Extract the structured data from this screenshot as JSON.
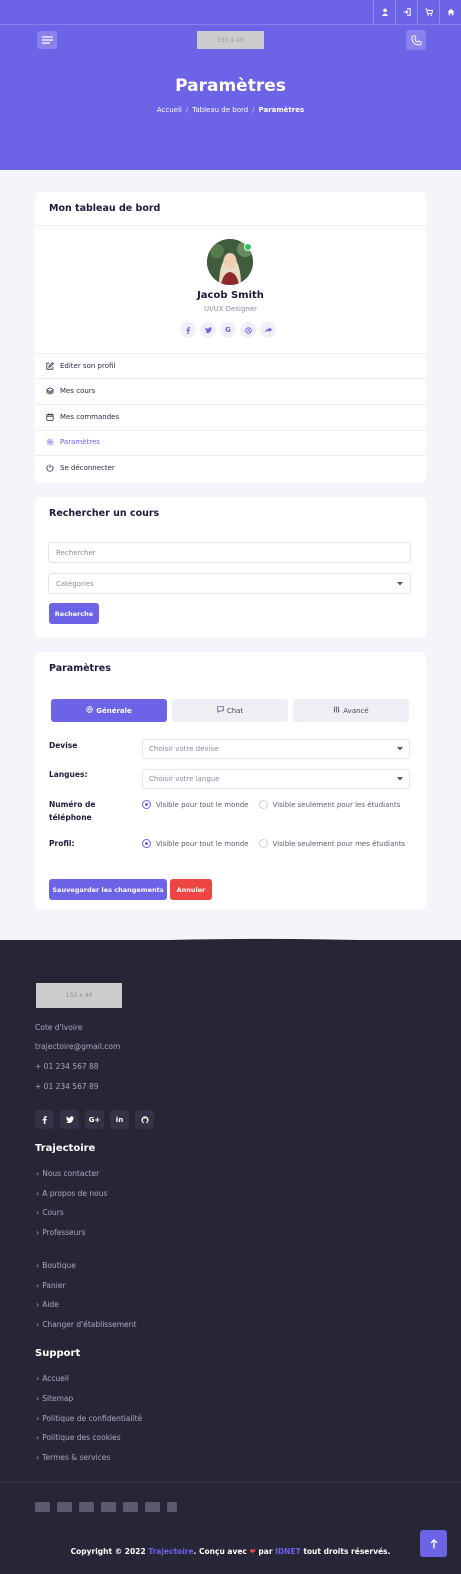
{
  "colors": {
    "primary": "#6c63e6",
    "danger": "#ef4444",
    "online": "#22c55e",
    "footer_bg": "#272637"
  },
  "topbar": {
    "icons": [
      "user-icon",
      "login-icon",
      "cart-icon",
      "home-icon"
    ]
  },
  "header": {
    "logo_placeholder": "150 x 40",
    "title": "Paramètres",
    "breadcrumb": {
      "home": "Accueil",
      "dashboard": "Tableau de bord",
      "current": "Paramètres"
    }
  },
  "dashboard": {
    "title": "Mon tableau de bord",
    "user": {
      "name": "Jacob Smith",
      "role": "UI/UX Designer"
    },
    "socials": [
      "facebook-icon",
      "twitter-icon",
      "google-icon",
      "dribbble-icon",
      "share-icon"
    ],
    "nav": [
      {
        "label": "Editer son profil",
        "icon": "edit-icon"
      },
      {
        "label": "Mes cours",
        "icon": "layers-icon"
      },
      {
        "label": "Mes commandes",
        "icon": "calendar-icon"
      },
      {
        "label": "Paramètres",
        "icon": "gear-icon"
      },
      {
        "label": "Se déconnecter",
        "icon": "power-icon"
      }
    ]
  },
  "search": {
    "title": "Rechercher un cours",
    "input_placeholder": "Rechercher",
    "category_placeholder": "Catégories",
    "button": "Recherche"
  },
  "settings": {
    "title": "Paramètres",
    "tabs": [
      {
        "label": "Générale",
        "icon": "globe-icon"
      },
      {
        "label": "Chat",
        "icon": "chat-icon"
      },
      {
        "label": "Avancé",
        "icon": "sliders-icon"
      }
    ],
    "currency": {
      "label": "Devise",
      "placeholder": "Choisir votre devise"
    },
    "languages": {
      "label": "Langues:",
      "placeholder": "Choisir votre langue"
    },
    "phone": {
      "label_line1": "Numéro de",
      "label_line2": "téléphone",
      "option1": "Visible pour tout le monde",
      "option2": "Visible seulement pour les étudiants"
    },
    "profile": {
      "label": "Profil:",
      "option1": "Visible pour tout le monde",
      "option2": "Visible seulement pour mes étudiants"
    },
    "save_button": "Sauvegarder les changements",
    "cancel_button": "Annuler"
  },
  "footer": {
    "logo_placeholder": "153 x 44",
    "contact": [
      "Cote d'Ivoire",
      "trajectoire@gmail.com",
      "+ 01 234 567 88",
      "+ 01 234 567 89"
    ],
    "socials": [
      "facebook-icon",
      "twitter-icon",
      "google-plus-icon",
      "linkedin-icon",
      "github-icon"
    ],
    "section1": {
      "title": "Trajectoire",
      "links": [
        "Nous contacter",
        "A propos de nous",
        "Cours",
        "Professeurs",
        "Boutique",
        "Panier",
        "Aide",
        "Changer d'établissement"
      ]
    },
    "section2": {
      "title": "Support",
      "links": [
        "Accueil",
        "Sitemap",
        "Politique de confidentialité",
        "Politique des cookies",
        "Termes & services"
      ]
    },
    "payments": [
      "amex-icon",
      "visa-icon",
      "card-icon",
      "mastercard-icon",
      "paypal-icon",
      "card2-icon",
      "stripe-icon"
    ],
    "copyright": {
      "prefix": "Copyright © 2022 ",
      "brand": "Trajectoire",
      "middle": ". Conçu avec ",
      "heart": "❤",
      "by": " par ",
      "company": "IDNET",
      "suffix": " tout droits réservés."
    }
  }
}
